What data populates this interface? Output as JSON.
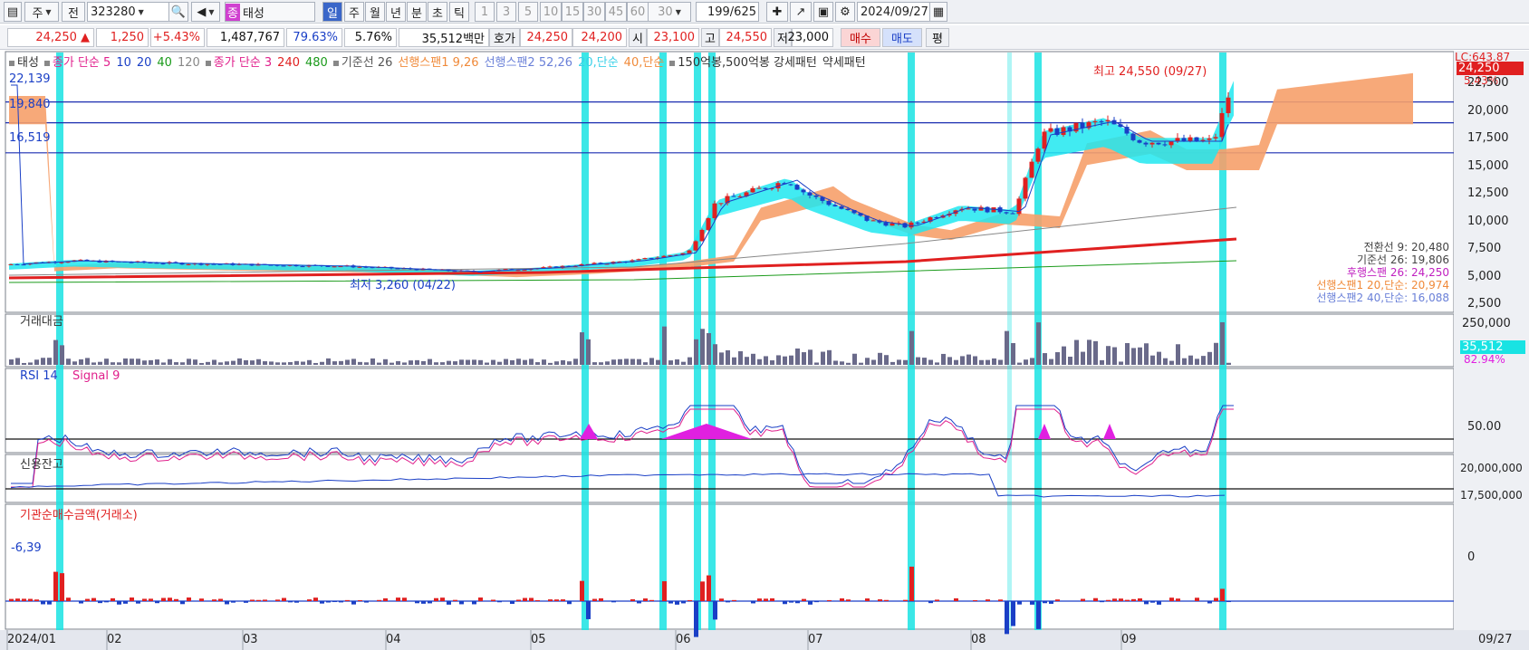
{
  "toolbar": {
    "period_label": "주",
    "prev_label": "전",
    "code": "323280",
    "search_glyph": "🔍",
    "sound_glyph": "◀",
    "tag": "종",
    "name": "태성",
    "periods": [
      "일",
      "주",
      "월",
      "년",
      "분",
      "초",
      "틱"
    ],
    "intervals": [
      "1",
      "3",
      "5",
      "10",
      "15",
      "30",
      "45",
      "60"
    ],
    "interval_selected": "30",
    "page_count": "199",
    "page_total": "/625",
    "date": "2024/09/27"
  },
  "quote": {
    "price": "24,250 ▲",
    "change": "1,250",
    "change_pct": "+5.43%",
    "volume": "1,487,767",
    "vol_ratio": "79.63%",
    "turnover": "5.76%",
    "amount": "35,512백만",
    "hoga_label": "호가",
    "ask": "24,250",
    "bid": "24,200",
    "open_label": "시",
    "open": "23,100",
    "high_label": "고",
    "high": "24,550",
    "low_label": "저",
    "low": "23,000",
    "buy_label": "매수",
    "sell_label": "매도",
    "avg_label": "평"
  },
  "price_pane": {
    "legend": [
      {
        "text": "태성",
        "color": "#333333"
      },
      {
        "text": "종가 단순 5",
        "color": "#e0208c"
      },
      {
        "text": "10",
        "color": "#1a3fc6"
      },
      {
        "text": "20",
        "color": "#1a3fc6"
      },
      {
        "text": "40",
        "color": "#1a9a1a"
      },
      {
        "text": "120",
        "color": "#888888"
      },
      {
        "text": "종가 단순 3",
        "color": "#e0208c"
      },
      {
        "text": "240",
        "color": "#e02020"
      },
      {
        "text": "480",
        "color": "#1a9a1a"
      },
      {
        "text": "기준선 26",
        "color": "#555555"
      },
      {
        "text": "선행스팬1 9,26",
        "color": "#f08a3a"
      },
      {
        "text": "선행스팬2 52,26",
        "color": "#6a80d8"
      },
      {
        "text": "20,단순",
        "color": "#3ad0e8"
      },
      {
        "text": "40,단순",
        "color": "#f08a3a"
      },
      {
        "text": "150억봉,500억봉 강세패턴",
        "color": "#333333"
      },
      {
        "text": "약세패턴",
        "color": "#333333"
      }
    ],
    "hlines": [
      {
        "label": "22,139",
        "value": 22139
      },
      {
        "label": "19,840",
        "value": 19840
      },
      {
        "label": "16,519",
        "value": 16519
      }
    ],
    "yticks": [
      "22,500",
      "20,000",
      "17,500",
      "15,000",
      "12,500",
      "10,000",
      "7,500",
      "5,000",
      "2,500"
    ],
    "lc_label": "LC:643.87",
    "last_price": "24,250",
    "last_pct": "5.43%",
    "high_note": "최고 24,550 (09/27)",
    "low_note": "최저 3,260 (04/22)",
    "ichimoku": [
      {
        "text": "전환선 9: 20,480",
        "color": "#444444"
      },
      {
        "text": "기준선 26: 19,806",
        "color": "#444444"
      },
      {
        "text": "후행스팬 26: 24,250",
        "color": "#c020c0"
      },
      {
        "text": "선행스팬1 20,단순: 20,974",
        "color": "#f08a3a"
      },
      {
        "text": "선행스팬2 40,단순: 16,088",
        "color": "#6a80d8"
      }
    ]
  },
  "value_pane": {
    "title": "거래대금",
    "ytick": "250,000",
    "last": "35,512",
    "pct": "82.94%"
  },
  "rsi_pane": {
    "title": "RSI 14",
    "signal": "Signal 9",
    "ytick": "50.00"
  },
  "credit_pane": {
    "title": "신용잔고",
    "yticks": [
      "20,000,000",
      "17,500,000"
    ]
  },
  "inst_pane": {
    "title": "기관순매수금액(거래소)",
    "last_label": "-6,39",
    "ytick": "0"
  },
  "xaxis": {
    "labels": [
      "2024/01",
      "02",
      "03",
      "04",
      "05",
      "06",
      "07",
      "08",
      "09"
    ],
    "right_label": "09/27"
  },
  "colors": {
    "up": "#e02020",
    "down": "#1a3fc6",
    "highlight": "#19e3e3",
    "cloud_up": "#20e8f0",
    "cloud_down": "#f6a06a"
  }
}
